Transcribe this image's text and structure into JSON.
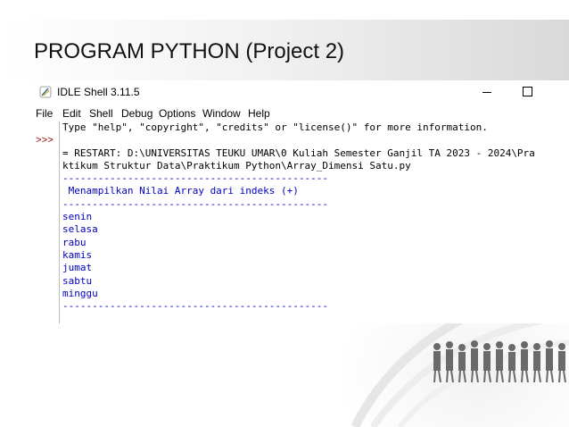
{
  "slide": {
    "title": "PROGRAM PYTHON (Project 2)"
  },
  "window": {
    "title": "IDLE Shell 3.11.5",
    "icons": {
      "app": "python-feather-icon",
      "minimize": "minimize-icon",
      "maximize": "maximize-icon"
    }
  },
  "menu": [
    "File",
    "Edit",
    "Shell",
    "Debug",
    "Options",
    "Window",
    "Help"
  ],
  "shell": {
    "prompt": ">>>",
    "lines": [
      "Type \"help\", \"copyright\", \"credits\" or \"license()\" for more information.",
      "",
      "= RESTART: D:\\UNIVERSITAS TEUKU UMAR\\0 Kuliah Semester Ganjil TA 2023 - 2024\\Pra",
      "ktikum Struktur Data\\Praktikum Python\\Array_Dimensi Satu.py",
      "---------------------------------------------",
      " Menampilkan Nilai Array dari indeks (+)",
      "---------------------------------------------",
      "senin",
      "selasa",
      "rabu",
      "kamis",
      "jumat",
      "sabtu",
      "minggu",
      "---------------------------------------------"
    ]
  },
  "colors": {
    "output": "#0000c0",
    "text": "#000000",
    "prompt": "#9b0000"
  }
}
